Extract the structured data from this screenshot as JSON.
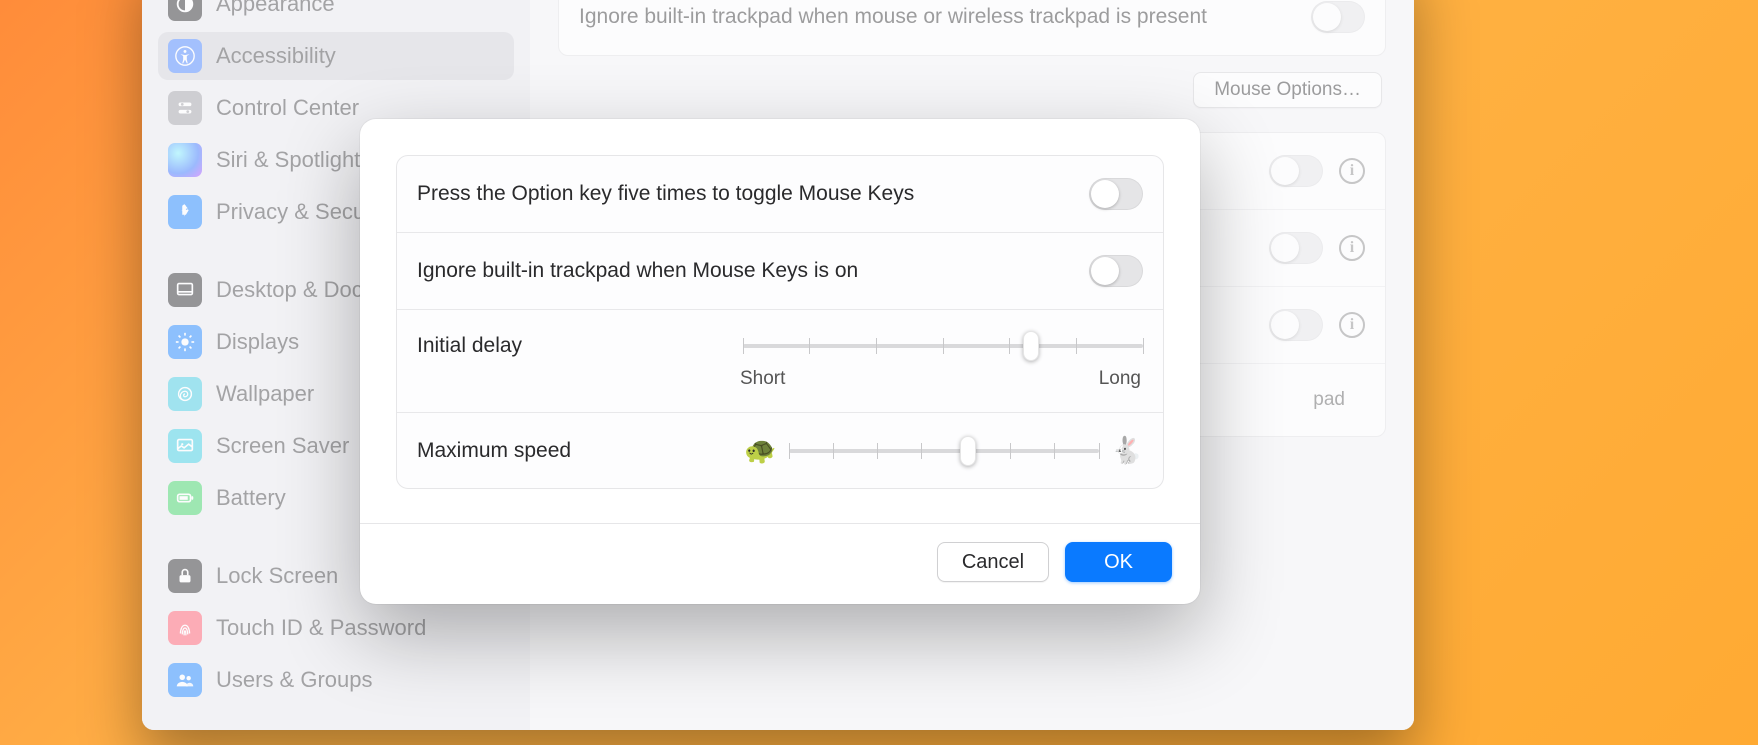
{
  "sidebar": {
    "items": [
      {
        "label": "Appearance"
      },
      {
        "label": "Accessibility"
      },
      {
        "label": "Control Center"
      },
      {
        "label": "Siri & Spotlight"
      },
      {
        "label": "Privacy & Security"
      },
      {
        "label": "Desktop & Dock"
      },
      {
        "label": "Displays"
      },
      {
        "label": "Wallpaper"
      },
      {
        "label": "Screen Saver"
      },
      {
        "label": "Battery"
      },
      {
        "label": "Lock Screen"
      },
      {
        "label": "Touch ID & Password"
      },
      {
        "label": "Users & Groups"
      }
    ]
  },
  "main": {
    "ignoreTrackpadLabel": "Ignore built-in trackpad when mouse or wireless trackpad is present",
    "mouseOptionsButton": "Mouse Options…",
    "hiddenRowDetail": "pad"
  },
  "sheet": {
    "optionKeyToggleLabel": "Press the Option key five times to toggle Mouse Keys",
    "ignoreTrackpadMouseKeysLabel": "Ignore built-in trackpad when Mouse Keys is on",
    "initialDelayLabel": "Initial delay",
    "initialDelayMin": "Short",
    "initialDelayMax": "Long",
    "initialDelayValuePercent": 72,
    "maxSpeedLabel": "Maximum speed",
    "maxSpeedValuePercent": 58,
    "cancelLabel": "Cancel",
    "okLabel": "OK"
  }
}
